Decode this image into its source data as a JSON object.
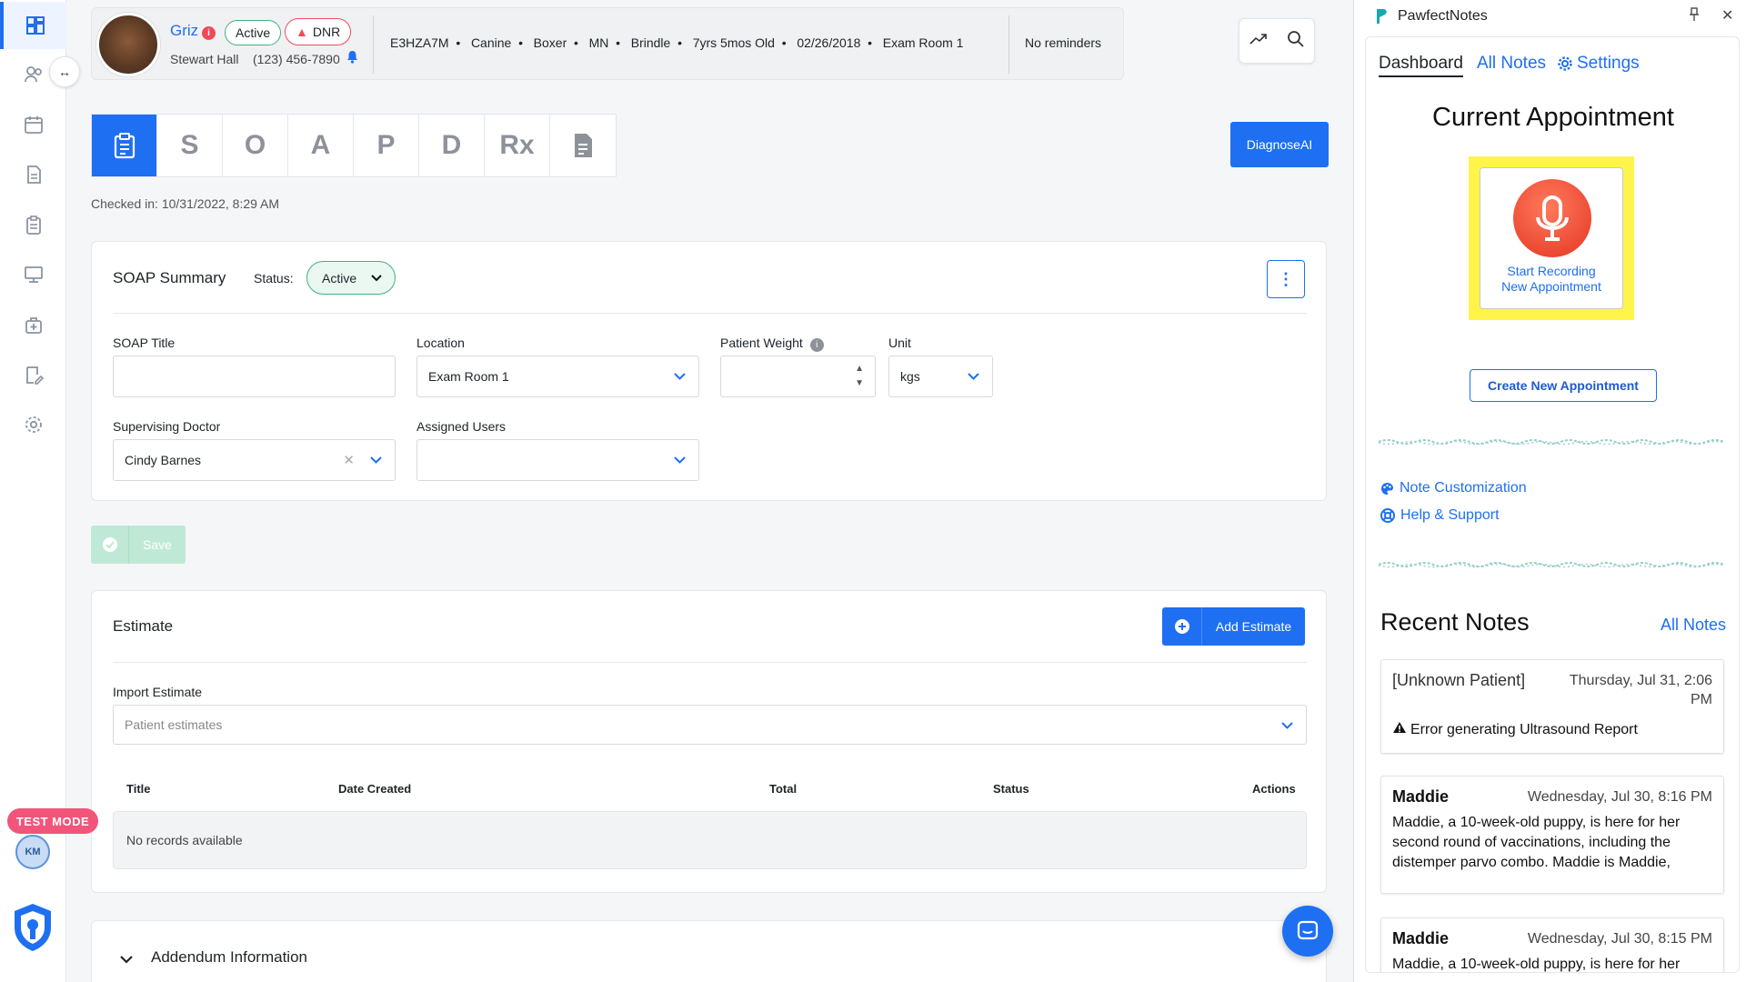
{
  "nav": {
    "items": [
      "dashboard",
      "patients",
      "calendar",
      "documents",
      "clipboard",
      "monitor",
      "medical-kit",
      "edit-notes",
      "settings"
    ]
  },
  "sidebar_footer": {
    "test_mode": "TEST MODE",
    "avatar_initials": "KM"
  },
  "patient": {
    "name": "Griz",
    "status": "Active",
    "alert": "DNR",
    "owner": "Stewart Hall",
    "phone": "(123) 456-7890",
    "details": [
      "E3HZA7M",
      "Canine",
      "Boxer",
      "MN",
      "Brindle",
      "7yrs 5mos Old",
      "02/26/2018",
      "Exam Room 1"
    ],
    "reminders": "No reminders"
  },
  "soap_tabs": [
    "S",
    "O",
    "A",
    "P",
    "D",
    "Rx"
  ],
  "checked_in": "Checked in: 10/31/2022, 8:29 AM",
  "diagnose_button": "DiagnoseAI",
  "soap_summary": {
    "title": "SOAP Summary",
    "status_label": "Status:",
    "status_value": "Active",
    "fields": {
      "soap_title_label": "SOAP Title",
      "soap_title_value": "",
      "location_label": "Location",
      "location_value": "Exam Room 1",
      "weight_label": "Patient Weight",
      "weight_value": "",
      "unit_label": "Unit",
      "unit_value": "kgs",
      "doctor_label": "Supervising Doctor",
      "doctor_value": "Cindy Barnes",
      "users_label": "Assigned Users",
      "users_value": ""
    }
  },
  "save_button": "Save",
  "estimate": {
    "title": "Estimate",
    "add_button": "Add Estimate",
    "import_label": "Import Estimate",
    "import_placeholder": "Patient estimates",
    "columns": [
      "Title",
      "Date Created",
      "Total",
      "Status",
      "Actions"
    ],
    "empty": "No records available"
  },
  "addendum": {
    "title": "Addendum Information"
  },
  "pawfect": {
    "app_title": "PawfectNotes",
    "tabs": [
      "Dashboard",
      "All Notes",
      "Settings"
    ],
    "current_title": "Current Appointment",
    "record_line1": "Start Recording",
    "record_line2": "New Appointment",
    "create_button": "Create New Appointment",
    "links": [
      "Note Customization",
      "Help & Support"
    ],
    "recent_title": "Recent Notes",
    "recent_all": "All Notes",
    "notes": [
      {
        "name": "[Unknown Patient]",
        "date": "Thursday, Jul 31, 2:06 PM",
        "body": "Error generating Ultrasound Report"
      },
      {
        "name": "Maddie",
        "date": "Wednesday, Jul 30, 8:16 PM",
        "body": "Maddie, a 10-week-old puppy, is here for her second round of vaccinations, including the distemper parvo combo. Maddie is Maddie,"
      },
      {
        "name": "Maddie",
        "date": "Wednesday, Jul 30, 8:15 PM",
        "body": "Maddie, a 10-week-old puppy, is here for her"
      }
    ]
  },
  "colors": {
    "primary": "#1e6ff2",
    "active_green": "#3fb37f",
    "dnr_red": "#f04a5a",
    "highlight": "#fff44a",
    "mic": "#ec4a33"
  }
}
